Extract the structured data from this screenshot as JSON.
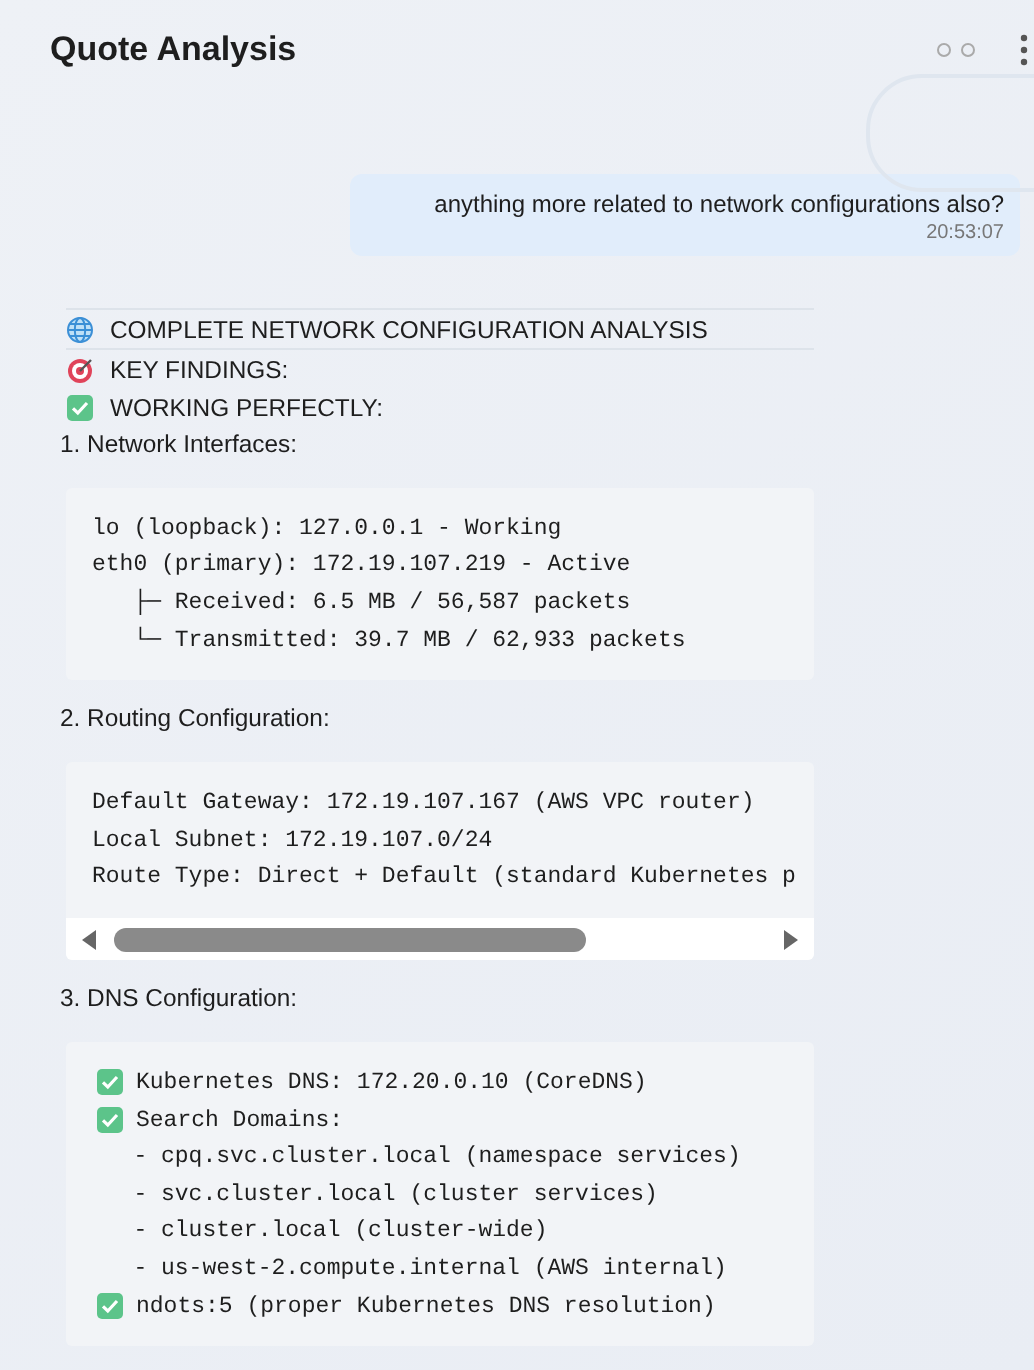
{
  "header": {
    "title": "Quote Analysis"
  },
  "user_message": {
    "text": "anything more related to network configurations also?",
    "time": "20:53:07"
  },
  "reply": {
    "headings": [
      {
        "kind": "globe",
        "text": "COMPLETE NETWORK CONFIGURATION ANALYSIS"
      },
      {
        "kind": "target",
        "text": "KEY FINDINGS:"
      },
      {
        "kind": "check",
        "text": "WORKING PERFECTLY:"
      }
    ],
    "sections": [
      {
        "title": "1. Network Interfaces:",
        "scrollbar": false,
        "lines": [
          {
            "kind": "plain",
            "text": "lo (loopback): 127.0.0.1 - Working"
          },
          {
            "kind": "plain",
            "text": "eth0 (primary): 172.19.107.219 - Active"
          },
          {
            "kind": "plain",
            "text": "   ├─ Received: 6.5 MB / 56,587 packets"
          },
          {
            "kind": "plain",
            "text": "   └─ Transmitted: 39.7 MB / 62,933 packets"
          }
        ]
      },
      {
        "title": "2. Routing Configuration:",
        "scrollbar": true,
        "lines": [
          {
            "kind": "plain",
            "text": "Default Gateway: 172.19.107.167 (AWS VPC router)"
          },
          {
            "kind": "plain",
            "text": "Local Subnet: 172.19.107.0/24"
          },
          {
            "kind": "plain",
            "text": "Route Type: Direct + Default (standard Kubernetes p"
          }
        ]
      },
      {
        "title": "3. DNS Configuration:",
        "scrollbar": false,
        "lines": [
          {
            "kind": "check",
            "text": "Kubernetes DNS: 172.20.0.10 (CoreDNS)"
          },
          {
            "kind": "check",
            "text": "Search Domains:"
          },
          {
            "kind": "plain",
            "text": "   - cpq.svc.cluster.local (namespace services)"
          },
          {
            "kind": "plain",
            "text": "   - svc.cluster.local (cluster services)"
          },
          {
            "kind": "plain",
            "text": "   - cluster.local (cluster-wide)"
          },
          {
            "kind": "plain",
            "text": "   - us-west-2.compute.internal (AWS internal)"
          },
          {
            "kind": "check",
            "text": "ndots:5 (proper Kubernetes DNS resolution)"
          }
        ]
      }
    ]
  }
}
